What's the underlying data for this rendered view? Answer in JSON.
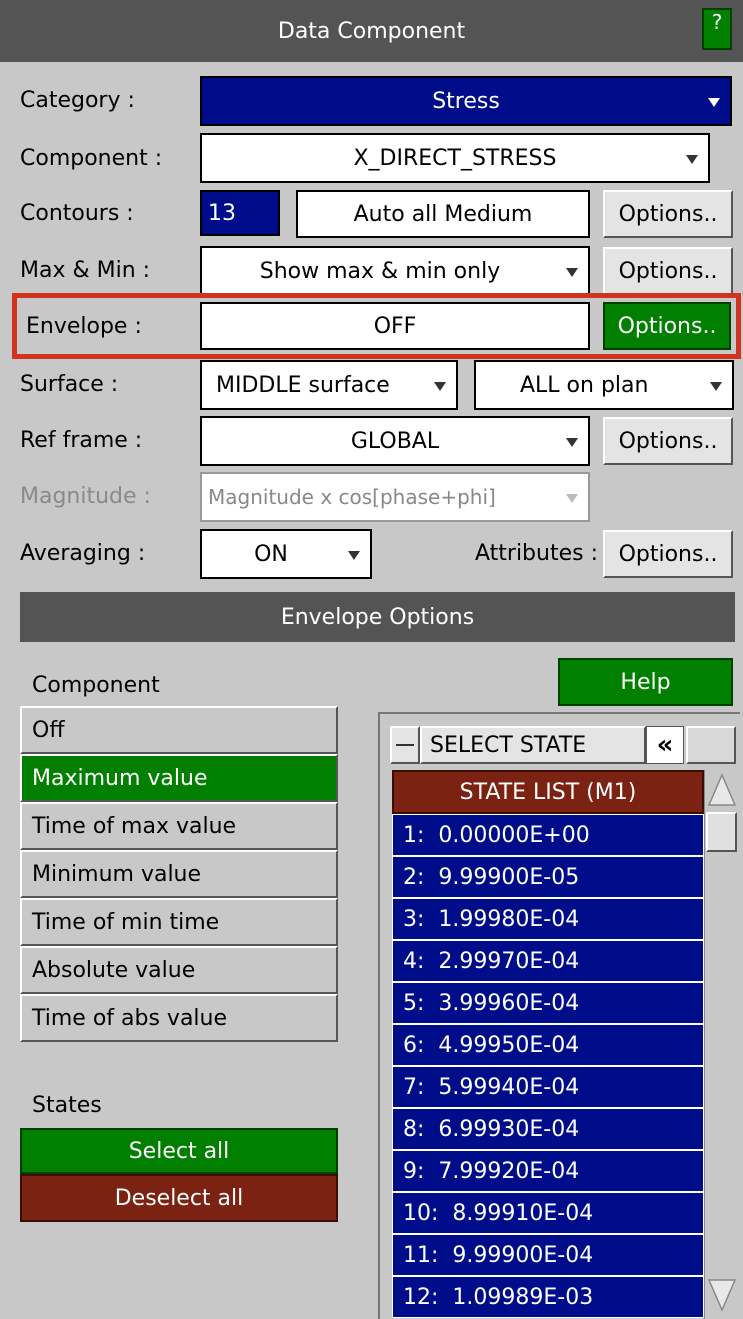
{
  "panel": {
    "title": "Data Component",
    "help_icon": "?"
  },
  "rows": {
    "category": {
      "label": "Category :",
      "value": "Stress"
    },
    "component": {
      "label": "Component :",
      "value": "X_DIRECT_STRESS"
    },
    "contours": {
      "label": "Contours :",
      "count": "13",
      "mode": "Auto all Medium",
      "options": "Options.."
    },
    "maxmin": {
      "label": "Max & Min :",
      "value": "Show max & min only",
      "options": "Options.."
    },
    "envelope": {
      "label": "Envelope :",
      "value": "OFF",
      "options": "Options.."
    },
    "surface": {
      "label": "Surface :",
      "value": "MIDDLE surface",
      "value2": "ALL on plan"
    },
    "refframe": {
      "label": "Ref frame :",
      "value": "GLOBAL",
      "options": "Options.."
    },
    "magnitude": {
      "label": "Magnitude :",
      "value": "Magnitude x cos[phase+phi]"
    },
    "averaging": {
      "label": "Averaging :",
      "value": "ON",
      "attributes_label": "Attributes :",
      "options": "Options.."
    }
  },
  "envelope_options": {
    "title": "Envelope Options",
    "component_label": "Component",
    "help": "Help",
    "components": [
      {
        "label": "Off",
        "selected": false
      },
      {
        "label": "Maximum value",
        "selected": true
      },
      {
        "label": "Time of max value",
        "selected": false
      },
      {
        "label": "Minimum value",
        "selected": false
      },
      {
        "label": "Time of min time",
        "selected": false
      },
      {
        "label": "Absolute value",
        "selected": false
      },
      {
        "label": "Time of abs value",
        "selected": false
      }
    ],
    "states_label": "States",
    "select_all": "Select all",
    "deselect_all": "Deselect all"
  },
  "state_list": {
    "select_state": "SELECT STATE",
    "collapse_icon": "«",
    "header": "STATE LIST (M1)",
    "items": [
      "1:  0.00000E+00",
      "2:  9.99900E-05",
      "3:  1.99980E-04",
      "4:  2.99970E-04",
      "5:  3.99960E-04",
      "6:  4.99950E-04",
      "7:  5.99940E-04",
      "8:  6.99930E-04",
      "9:  7.99920E-04",
      "10:  8.99910E-04",
      "11:  9.99900E-04",
      "12:  1.09989E-03"
    ]
  },
  "colors": {
    "header_bg": "#545454",
    "panel_bg": "#c8c8c8",
    "blue": "#000d8a",
    "green": "#007f00",
    "dark_red": "#7b2212",
    "highlight": "#d0341f"
  }
}
